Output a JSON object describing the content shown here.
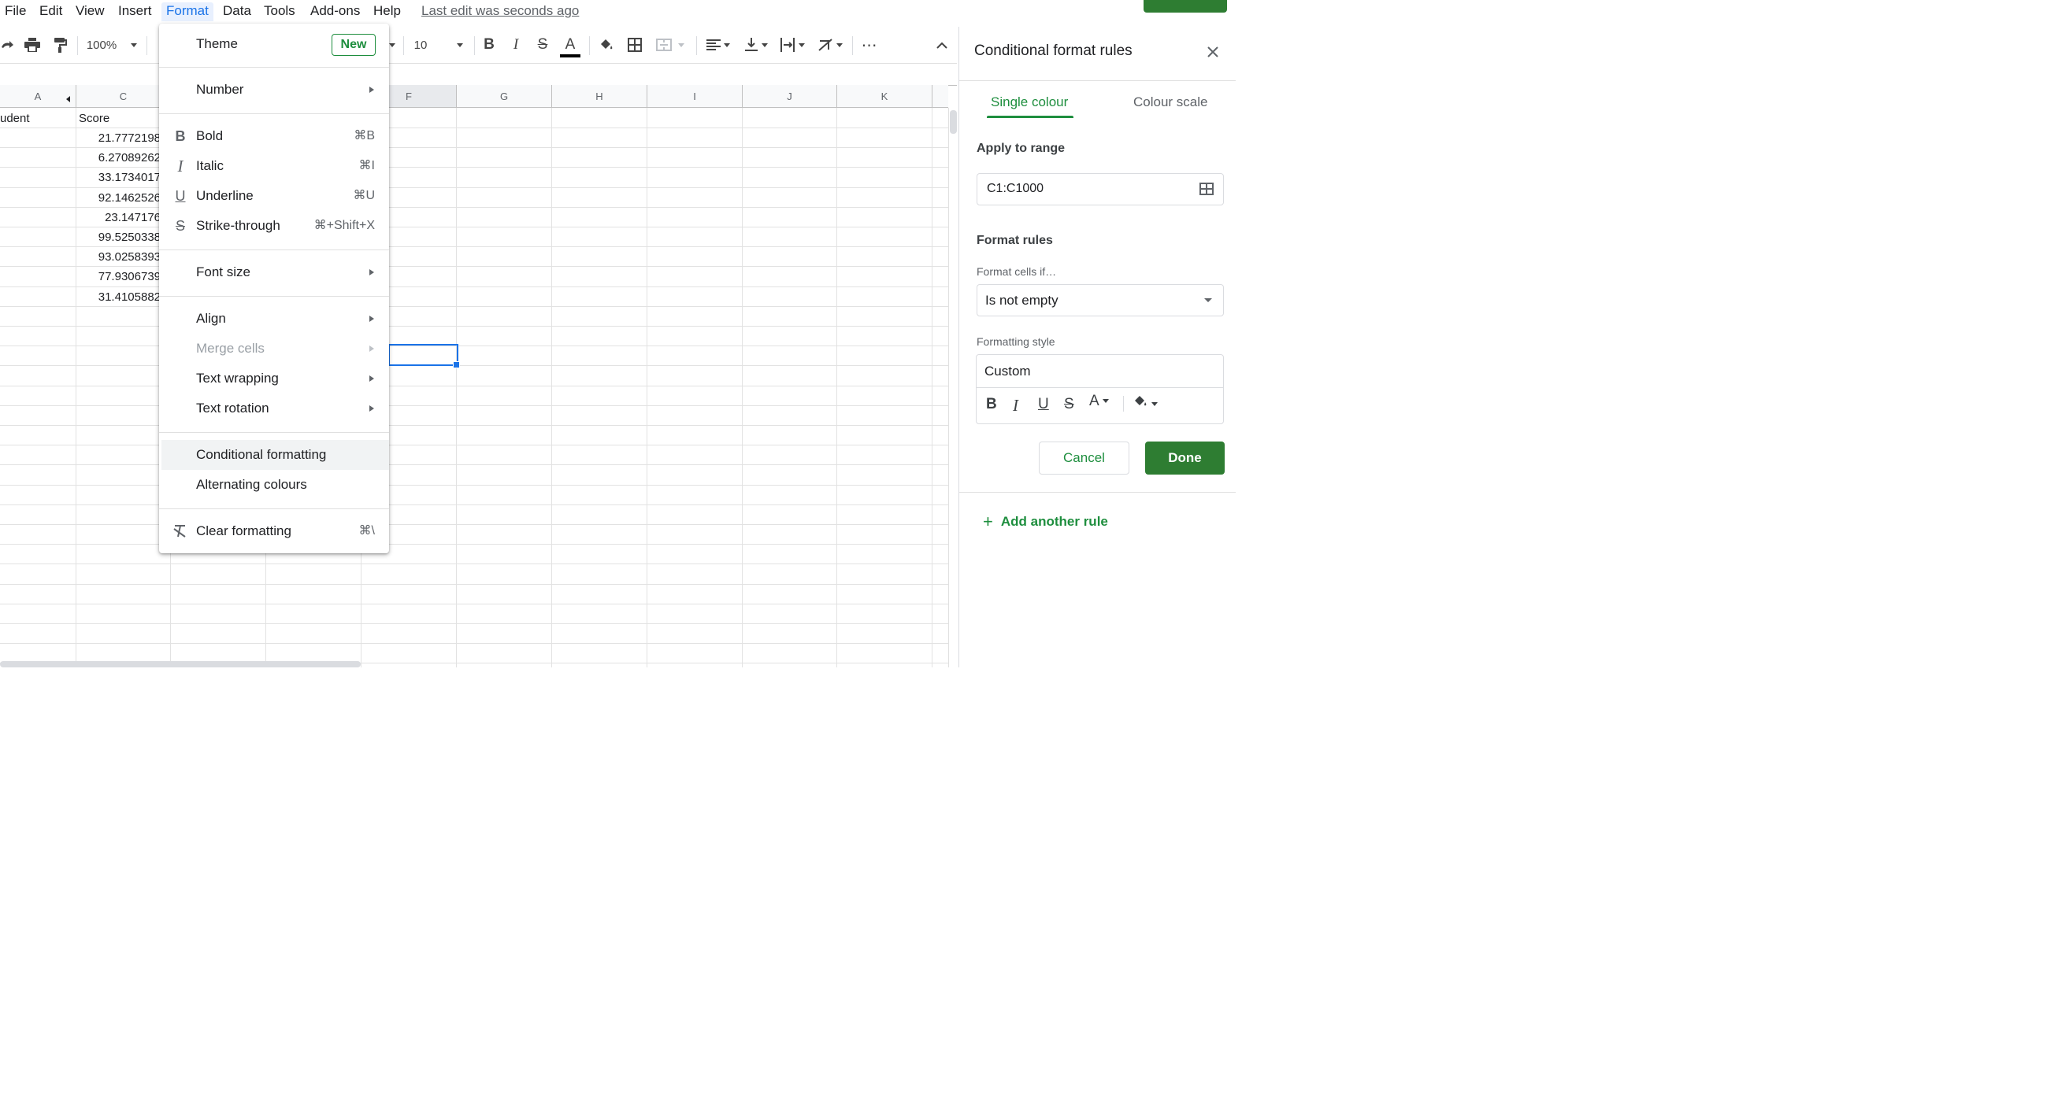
{
  "menubar": {
    "items": [
      "File",
      "Edit",
      "View",
      "Insert",
      "Format",
      "Data",
      "Tools",
      "Add-ons",
      "Help"
    ],
    "last_edit": "Last edit was seconds ago"
  },
  "toolbar": {
    "zoom": "100%",
    "font_size": "10"
  },
  "grid": {
    "columns": [
      "A",
      "C",
      "F",
      "G",
      "H",
      "I",
      "J",
      "K"
    ],
    "header_row": {
      "a": "udent",
      "c": "Score"
    },
    "scores": [
      "21.7772198",
      "6.27089262",
      "33.1734017",
      "92.1462526",
      "23.147176",
      "99.5250338",
      "93.0258393",
      "77.9306739",
      "31.4105882"
    ]
  },
  "format_menu": {
    "theme": "Theme",
    "new_badge": "New",
    "number": "Number",
    "bold": "Bold",
    "bold_sc": "⌘B",
    "italic": "Italic",
    "italic_sc": "⌘I",
    "underline": "Underline",
    "underline_sc": "⌘U",
    "strike": "Strike-through",
    "strike_sc": "⌘+Shift+X",
    "font_size": "Font size",
    "align": "Align",
    "merge": "Merge cells",
    "wrapping": "Text wrapping",
    "rotation": "Text rotation",
    "conditional": "Conditional formatting",
    "alternating": "Alternating colours",
    "clear": "Clear formatting",
    "clear_sc": "⌘\\"
  },
  "panel": {
    "title": "Conditional format rules",
    "tab_single": "Single colour",
    "tab_scale": "Colour scale",
    "apply_label": "Apply to range",
    "range": "C1:C1000",
    "format_rules": "Format rules",
    "cells_if": "Format cells if…",
    "condition": "Is not empty",
    "style_label": "Formatting style",
    "style_name": "Custom",
    "cancel": "Cancel",
    "done": "Done",
    "add_rule": "Add another rule"
  },
  "colors": {
    "accent_green": "#1e8e3e",
    "done_green": "#2e7d32",
    "selection_blue": "#1a73e8"
  }
}
